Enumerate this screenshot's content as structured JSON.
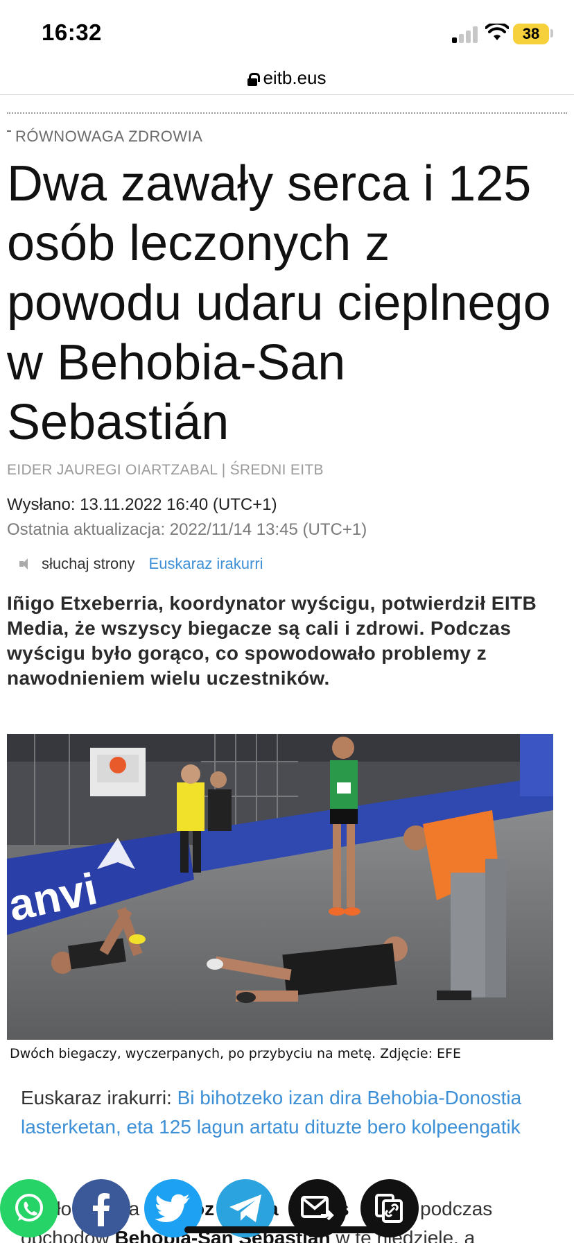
{
  "status": {
    "time": "16:32",
    "battery": "38"
  },
  "browser": {
    "domain": "eitb.eus"
  },
  "article": {
    "section": "RÓWNOWAGA ZDROWIA",
    "headline": "Dwa zawały serca i 125 osób leczonych z powodu udaru cieplnego w Behobia-San Sebastián",
    "byline": "EIDER JAUREGI OIARTZABAL | ŚREDNI EITB",
    "sent": "Wysłano: 13.11.2022 16:40 (UTC+1)",
    "updated": "Ostatnia aktualizacja: 2022/11/14 13:45 (UTC+1)",
    "listen_label": "słuchaj strony",
    "basque_link": "Euskaraz irakurri",
    "lead": "Iñigo Etxeberria, koordynator wyścigu, potwierdził EITB Media, że wszyscy biegacze są cali i zdrowi. Podczas wyścigu było gorąco, co spowodowało problemy z nawodnieniem wielu uczestników.",
    "photo_caption": "Dwóch biegaczy, wyczerpanych, po przybyciu na metę. Zdjęcie: EFE",
    "basque_prefix": "Euskaraz irakurri: ",
    "basque_title": "Bi bihotzeko izan dira Behobia-Donostia lasterketan, eta 125 lagun artatu dituzte bero kolpeengatik",
    "body_start": "Około",
    "body_mid": "ga",
    "body_mid2": "oz",
    "body_mid3": "za",
    "body_mid4": "s",
    "body_end": "podczas",
    "body_line2_prefix": "obchodów ",
    "body_line2_bold": "Behobia-San Sebastián",
    "body_line2_suffix": " w tę niedzielę, a"
  },
  "photo_sign": {
    "banner_text": "anvi"
  },
  "share": [
    {
      "name": "whatsapp",
      "color": "#25d366"
    },
    {
      "name": "facebook",
      "color": "#3b5998"
    },
    {
      "name": "twitter",
      "color": "#1da1f2"
    },
    {
      "name": "telegram",
      "color": "#2aa3de"
    },
    {
      "name": "email",
      "color": "#111111"
    },
    {
      "name": "copy-link",
      "color": "#111111"
    }
  ]
}
